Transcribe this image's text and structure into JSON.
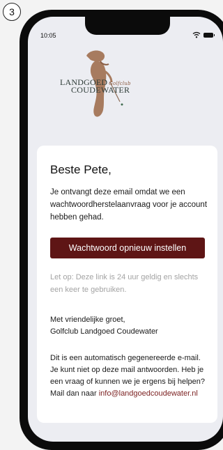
{
  "step": {
    "number": "3"
  },
  "status_bar": {
    "time": "10:05",
    "wifi_icon": "wifi-icon",
    "battery_icon": "battery-icon"
  },
  "logo": {
    "line1": "LANDGOED",
    "script": "Golfclub",
    "line2": "COUDEWATER",
    "colors": {
      "text": "#2d3b36",
      "figure": "#a77b5f"
    }
  },
  "email": {
    "greeting": "Beste Pete,",
    "intro": "Je ontvangt deze email omdat we een wachtwoordherstelaanvraag voor je account hebben gehad.",
    "reset_button": "Wachtwoord opnieuw instellen",
    "note": "Let op: Deze link is 24 uur geldig en slechts een keer te gebruiken.",
    "signoff_line1": "Met vriendelijke groet,",
    "signoff_line2": "Golfclub Landgoed Coudewater",
    "auto_message": "Dit is een automatisch gegenereerde e-mail. Je kunt niet op deze mail antwoorden. Heb je een vraag of kunnen we je ergens bij helpen? Mail dan naar",
    "contact_email": "info@landgoedcoudewater.nl"
  },
  "colors": {
    "button": "#5e1515",
    "link": "#7a1f1f",
    "background": "#ecedf2"
  }
}
